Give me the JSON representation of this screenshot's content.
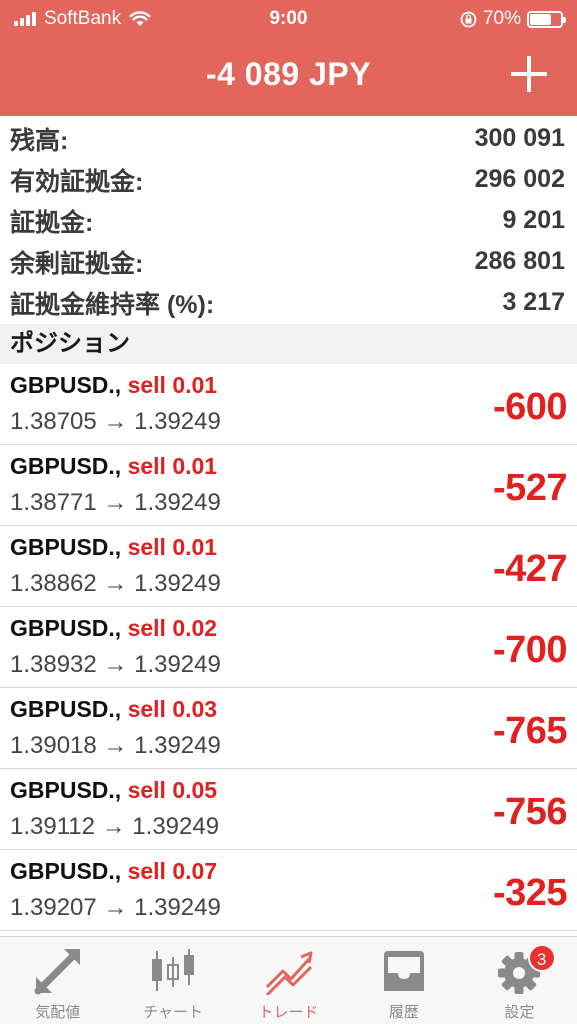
{
  "status_bar": {
    "carrier": "SoftBank",
    "time": "9:00",
    "battery": "70%",
    "battery_level": 0.7
  },
  "header": {
    "title": "-4 089 JPY"
  },
  "summary": [
    {
      "label": "残高:",
      "value": "300 091"
    },
    {
      "label": "有効証拠金:",
      "value": "296 002"
    },
    {
      "label": "証拠金:",
      "value": "9 201"
    },
    {
      "label": "余剰証拠金:",
      "value": "286 801"
    },
    {
      "label": "証拠金維持率 (%):",
      "value": "3 217"
    }
  ],
  "section_title": "ポジション",
  "positions": [
    {
      "symbol": "GBPUSD.,",
      "side": "sell 0.01",
      "prices": "1.38705 → 1.39249",
      "profit": "-600"
    },
    {
      "symbol": "GBPUSD.,",
      "side": "sell 0.01",
      "prices": "1.38771 → 1.39249",
      "profit": "-527"
    },
    {
      "symbol": "GBPUSD.,",
      "side": "sell 0.01",
      "prices": "1.38862 → 1.39249",
      "profit": "-427"
    },
    {
      "symbol": "GBPUSD.,",
      "side": "sell 0.02",
      "prices": "1.38932 → 1.39249",
      "profit": "-700"
    },
    {
      "symbol": "GBPUSD.,",
      "side": "sell 0.03",
      "prices": "1.39018 → 1.39249",
      "profit": "-765"
    },
    {
      "symbol": "GBPUSD.,",
      "side": "sell 0.05",
      "prices": "1.39112 → 1.39249",
      "profit": "-756"
    },
    {
      "symbol": "GBPUSD.,",
      "side": "sell 0.07",
      "prices": "1.39207 → 1.39249",
      "profit": "-325"
    }
  ],
  "tabs": [
    {
      "label": "気配値",
      "icon": "quotes-arrows-icon"
    },
    {
      "label": "チャート",
      "icon": "candlestick-chart-icon"
    },
    {
      "label": "トレード",
      "icon": "trade-trend-icon"
    },
    {
      "label": "履歴",
      "icon": "history-inbox-icon"
    },
    {
      "label": "設定",
      "icon": "gear-icon",
      "badge": "3"
    }
  ],
  "colors": {
    "header": "#e3665d",
    "loss": "#e12020",
    "active_tab": "#e3665d",
    "inactive_tab": "#8a8a8a"
  }
}
